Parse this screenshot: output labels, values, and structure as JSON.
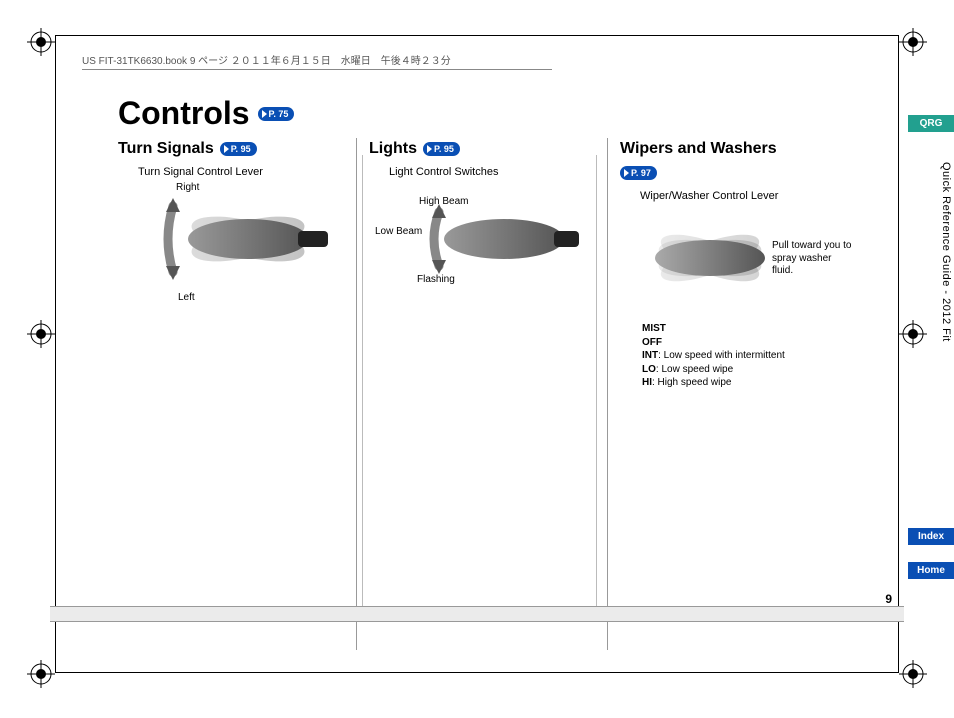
{
  "print_header": "US FIT-31TK6630.book  9 ページ  ２０１１年６月１５日　水曜日　午後４時２３分",
  "title": "Controls",
  "title_pill": "P. 75",
  "columns": {
    "turn_signals": {
      "heading": "Turn Signals",
      "pill": "P. 95",
      "caption": "Turn Signal Control Lever",
      "right": "Right",
      "left": "Left"
    },
    "lights": {
      "heading": "Lights",
      "pill": "P. 95",
      "caption": "Light Control Switches",
      "high": "High Beam",
      "low": "Low Beam",
      "flash": "Flashing"
    },
    "wipers": {
      "heading": "Wipers and Washers",
      "pill": "P. 97",
      "caption": "Wiper/Washer Control Lever",
      "spray": "Pull toward you to spray washer fluid.",
      "modes": {
        "mist": "MIST",
        "off": "OFF",
        "int_label": "INT",
        "int_text": ": Low speed with intermittent",
        "lo_label": "LO",
        "lo_text": ": Low speed wipe",
        "hi_label": "HI",
        "hi_text": ": High speed wipe"
      }
    }
  },
  "side": {
    "qrg": "QRG",
    "guide": "Quick Reference Guide - 2012 Fit",
    "index": "Index",
    "home": "Home"
  },
  "page_number": "9"
}
